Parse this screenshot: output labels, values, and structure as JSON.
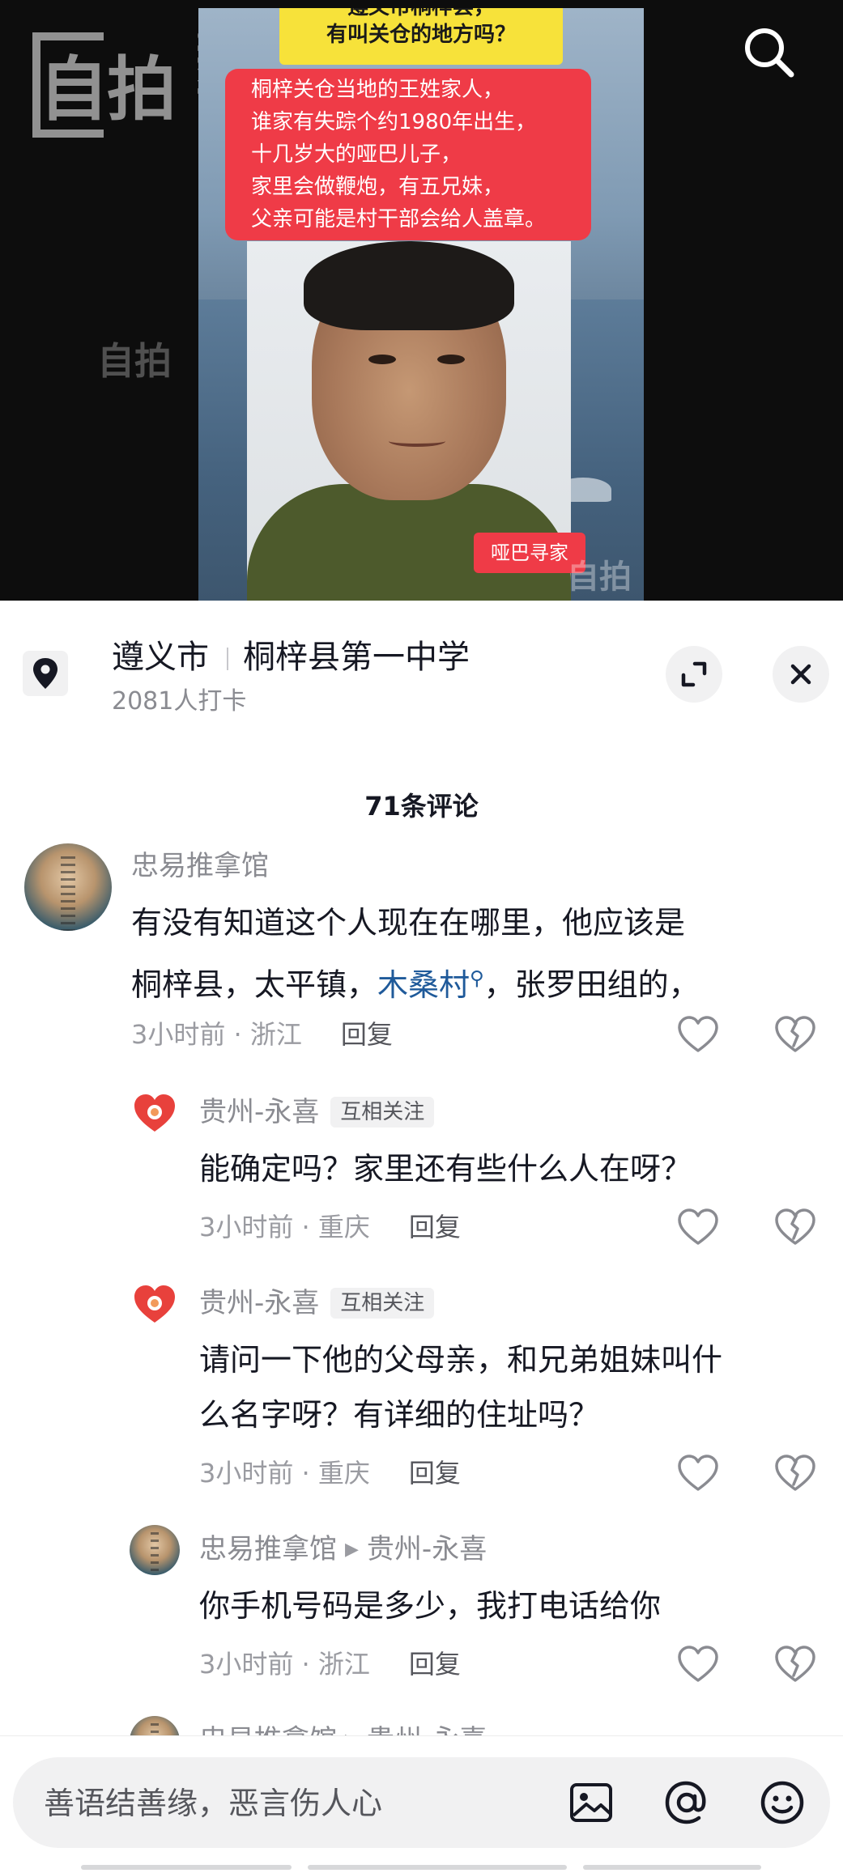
{
  "video": {
    "banner_top_line1": "遵义市桐梓县，",
    "banner_top_line2": "有叫关仓的地方吗？",
    "red_box_lines": [
      "桐梓关仓当地的王姓家人，",
      "谁家有失踪个约1980年出生，",
      "十几岁大的哑巴儿子，",
      "家里会做鞭炮，有五兄妹，",
      "父亲可能是村干部会给人盖章。"
    ],
    "tag": "哑巴寻家",
    "watermark_brand": "自拍",
    "watermark_selfie": "SELFIE"
  },
  "location": {
    "city": "遵义市",
    "place": "桐梓县第一中学",
    "checkins": "2081人打卡"
  },
  "comments_header": "71条评论",
  "comments": [
    {
      "user": "忠易推拿馆",
      "text_line1": "有没有知道这个人现在在哪里，他应该是",
      "text_line2_pre": "桐梓县，太平镇，",
      "text_link": "木桑村",
      "text_line2_post": "，张罗田组的，",
      "time": "3小时前 · 浙江",
      "reply": "回复"
    },
    {
      "user": "贵州-永喜",
      "badge": "互相关注",
      "text_line1": "能确定吗？家里还有些什么人在呀？",
      "time": "3小时前 · 重庆",
      "reply": "回复"
    },
    {
      "user": "贵州-永喜",
      "badge": "互相关注",
      "text_line1": "请问一下他的父母亲，和兄弟姐妹叫什",
      "text_line2": "么名字呀？有详细的住址吗？",
      "time": "3小时前 · 重庆",
      "reply": "回复"
    },
    {
      "user": "忠易推拿馆",
      "reply_to": "贵州-永喜",
      "text_line1": "你手机号码是多少，我打电话给你",
      "time": "3小时前 · 浙江",
      "reply": "回复"
    },
    {
      "user": "忠易推拿馆",
      "reply_to": "贵州-永喜"
    }
  ],
  "input": {
    "placeholder": "善语结善缘，恶言伤人心"
  },
  "icons": {
    "search": "search-icon",
    "location": "location-pin-icon",
    "expand": "expand-icon",
    "close": "close-icon",
    "like": "heart-icon",
    "dislike": "broken-heart-icon",
    "image": "image-icon",
    "mention": "at-icon",
    "emoji": "emoji-icon",
    "reply_arrow": "reply-arrow-icon"
  },
  "colors": {
    "banner_yellow": "#f7e23a",
    "banner_red": "#ef3b47",
    "link_blue": "#1f5a9a",
    "meta_gray": "#9a9ba1"
  }
}
